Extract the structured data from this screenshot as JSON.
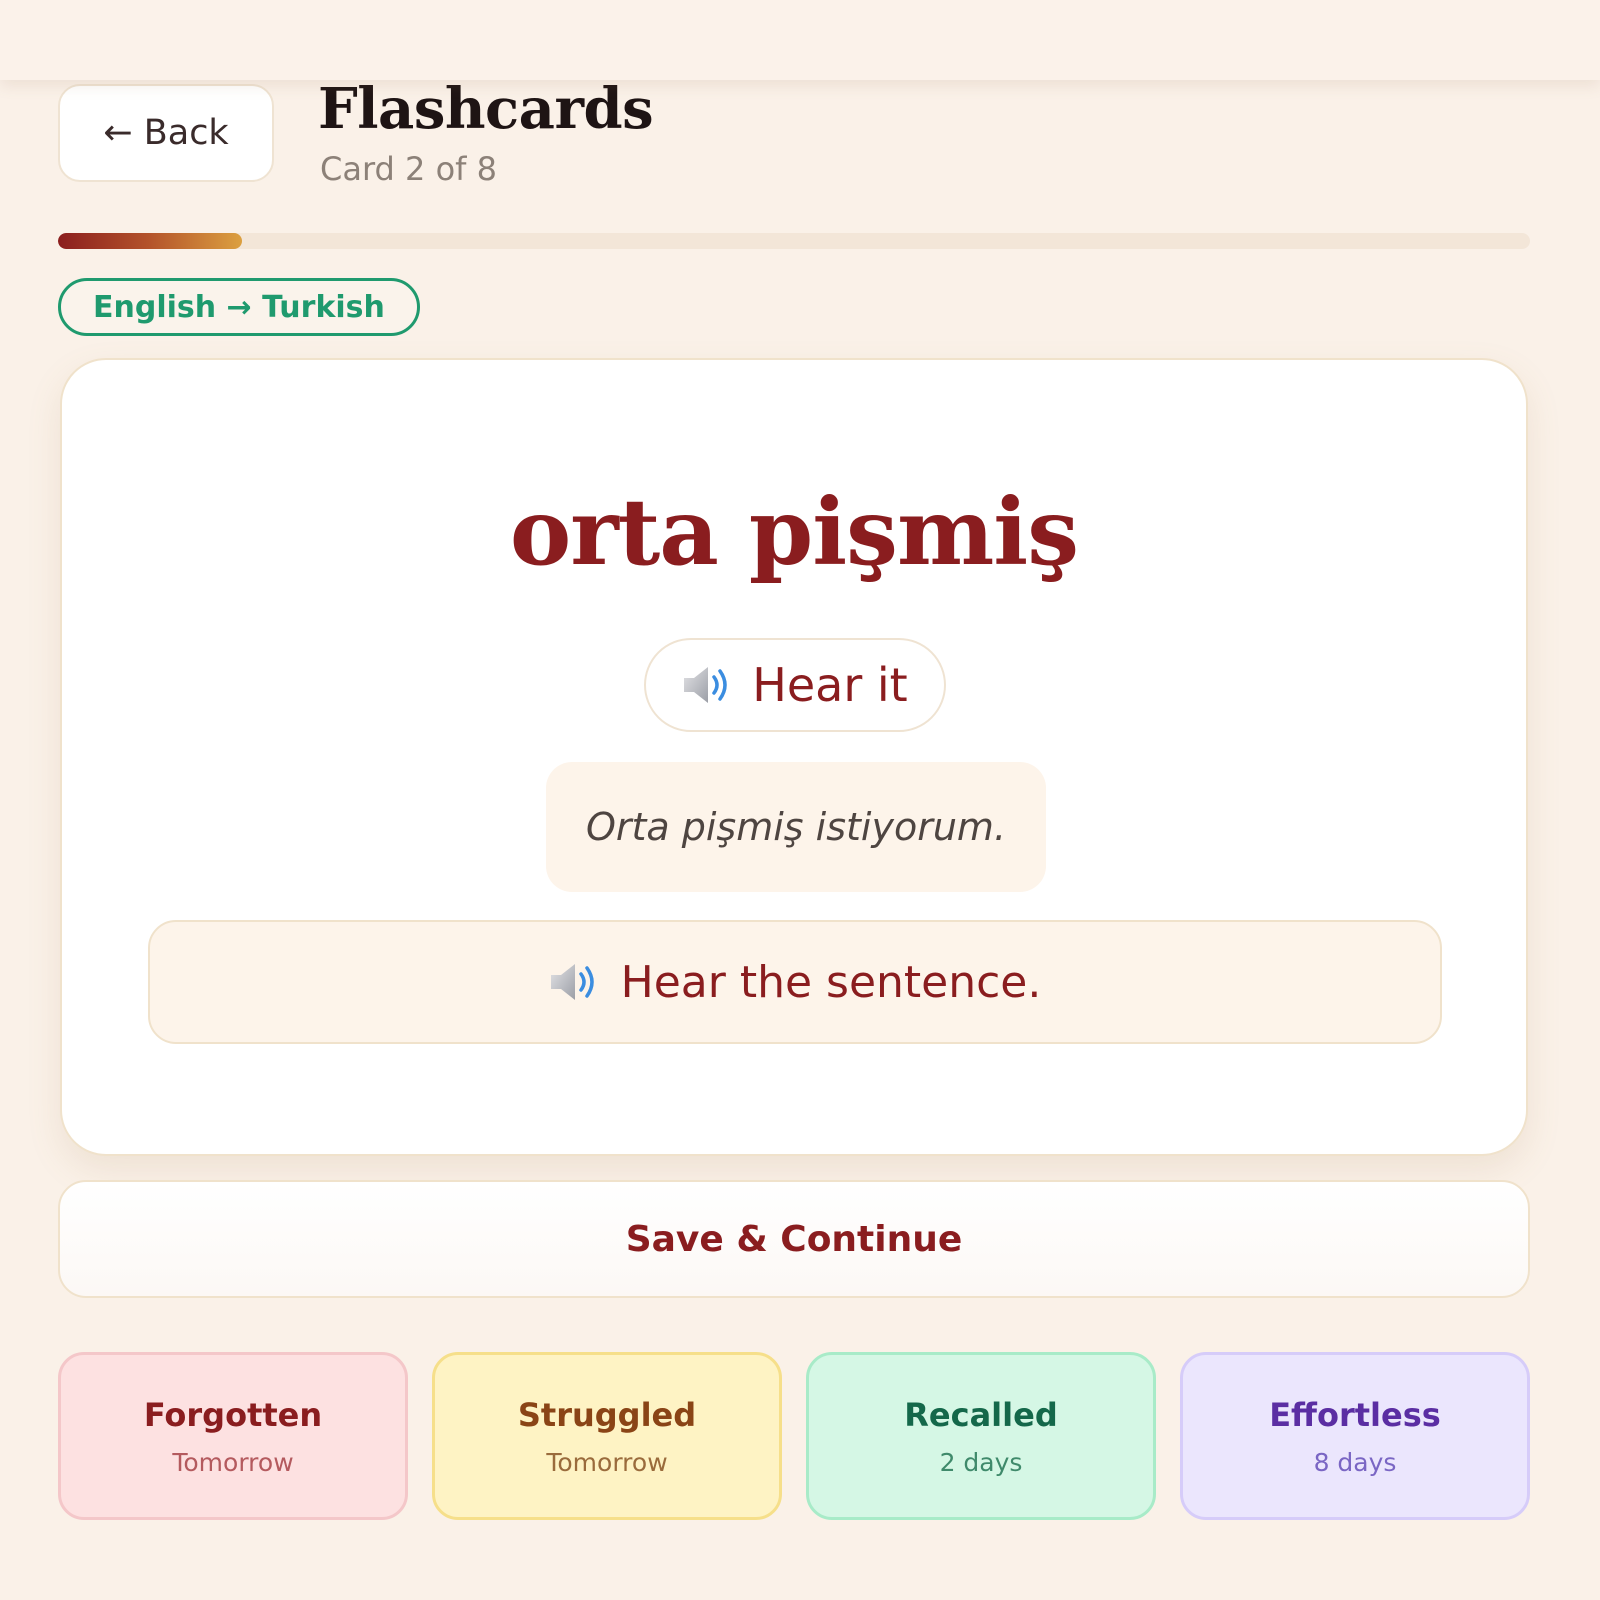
{
  "header": {
    "back_label": "← Back",
    "title": "Flashcards",
    "subtitle": "Card 2 of 8"
  },
  "progress": {
    "current": 2,
    "total": 8,
    "fraction": 0.125
  },
  "direction_badge": "English → Turkish",
  "card": {
    "word": "orta pişmiş",
    "hear_label": "Hear it",
    "example_sentence": "Orta pişmiş istiyorum.",
    "hear_sentence_label": "Hear the sentence."
  },
  "save_label": "Save & Continue",
  "ratings": [
    {
      "label": "Forgotten",
      "interval": "Tomorrow"
    },
    {
      "label": "Struggled",
      "interval": "Tomorrow"
    },
    {
      "label": "Recalled",
      "interval": "2 days"
    },
    {
      "label": "Effortless",
      "interval": "8 days"
    }
  ],
  "icons": {
    "speaker": "speaker-icon"
  },
  "colors": {
    "accent": "#8a1d1f",
    "badge": "#1f9a6e",
    "background": "#faf1e8"
  }
}
